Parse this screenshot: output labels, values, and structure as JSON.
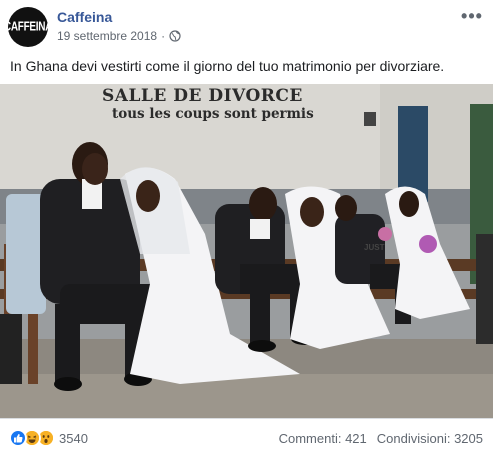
{
  "post": {
    "page_name": "Caffeina",
    "avatar_text": "CAFFEINA",
    "date": "19 settembre 2018",
    "separator": "·",
    "more_label": "•••",
    "caption": "In Ghana devi vestirti come il giorno del tuo matrimonio per divorziare."
  },
  "photo": {
    "wall_line1": "SALLE DE DIVORCE",
    "wall_line2": "tous les coups sont permis",
    "dress_text": "JUST"
  },
  "footer": {
    "reaction_icons": [
      "like-icon",
      "haha-icon",
      "wow-icon"
    ],
    "reaction_count": "3540",
    "comments": "Commenti: 421",
    "shares": "Condivisioni: 3205"
  },
  "colors": {
    "page_name": "#385898",
    "secondary_text": "#606770",
    "like": "#1877f2",
    "emoji": "#f7b125"
  }
}
